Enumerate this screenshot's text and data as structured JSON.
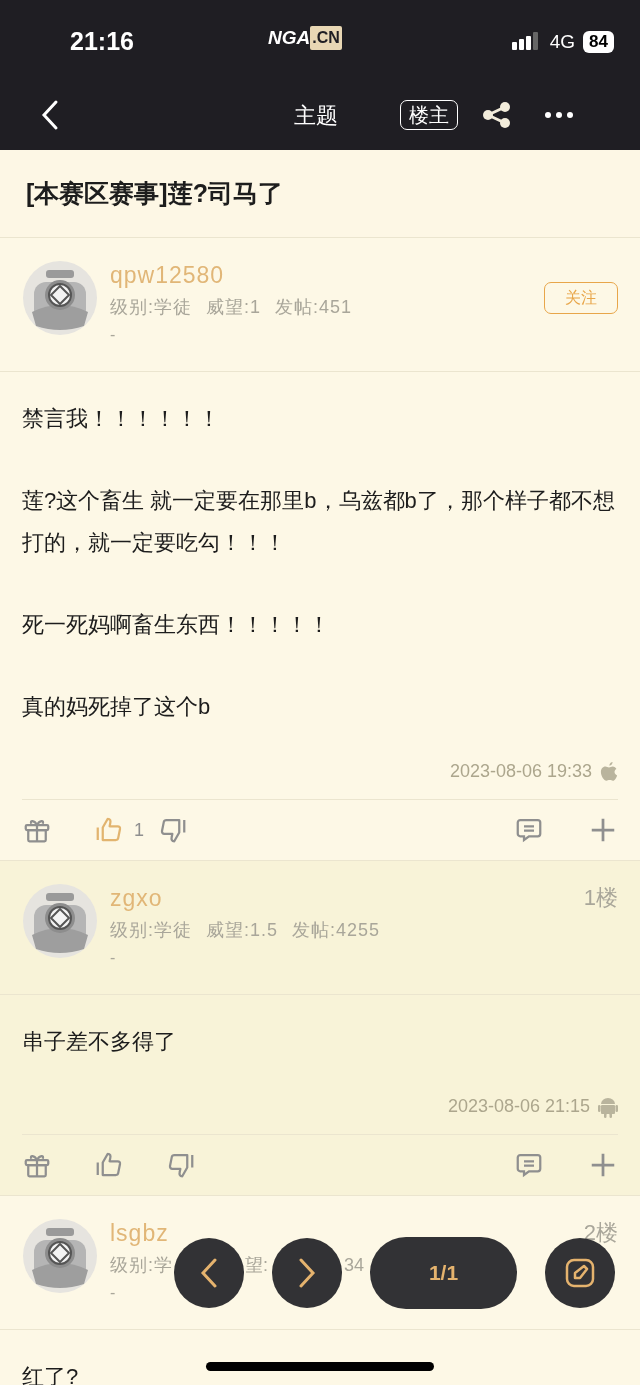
{
  "status_bar": {
    "time": "21:16",
    "network": "4G",
    "battery": "84"
  },
  "logo": {
    "main": "NGA",
    "suffix": ".CN"
  },
  "nav": {
    "title": "主题",
    "op_button": "楼主"
  },
  "thread_title": "[本赛区赛事]莲?司马了",
  "posts": [
    {
      "user": "qpw12580",
      "stats": [
        "级别:学徒",
        "威望:1",
        "发帖:451"
      ],
      "signature": "-",
      "follow": "关注",
      "highlighted": false,
      "paragraphs": [
        "禁言我！！！！！！",
        "莲?这个畜生 就一定要在那里b，乌兹都b了，那个样子都不想打的，就一定要吃勾！！！",
        "死一死妈啊畜生东西！！！！！",
        "真的妈死掉了这个b"
      ],
      "time": "2023-08-06 19:33",
      "device": {
        "kind": "apple"
      },
      "liked": true,
      "likes": "1"
    },
    {
      "user": "zgxo",
      "floor": "1楼",
      "stats": [
        "级别:学徒",
        "威望:1.5",
        "发帖:4255"
      ],
      "signature": "-",
      "highlighted": true,
      "paragraphs": [
        "串子差不多得了"
      ],
      "time": "2023-08-06 21:15",
      "device": {
        "kind": "android"
      },
      "liked": false
    },
    {
      "user": "lsgbz",
      "floor": "2楼",
      "stats": [
        "级别:学",
        "望:",
        "34"
      ],
      "stats_covered": true,
      "signature": "-",
      "highlighted": false,
      "paragraphs": [
        "红了?"
      ]
    }
  ],
  "pager": {
    "page": "1/1"
  }
}
